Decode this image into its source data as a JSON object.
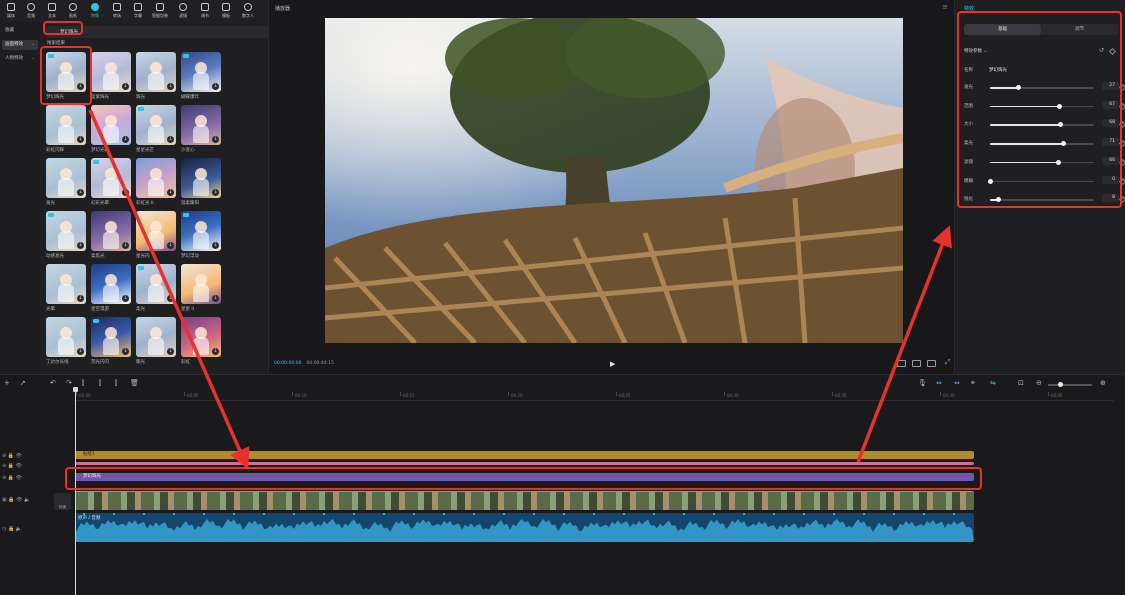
{
  "toolbar": {
    "items": [
      {
        "label": "媒体",
        "icon": "media-icon"
      },
      {
        "label": "音频",
        "icon": "audio-icon"
      },
      {
        "label": "文本",
        "icon": "text-icon"
      },
      {
        "label": "贴纸",
        "icon": "sticker-icon"
      },
      {
        "label": "特效",
        "icon": "effects-icon",
        "active": true
      },
      {
        "label": "转场",
        "icon": "transition-icon"
      },
      {
        "label": "字幕",
        "icon": "subtitle-icon"
      },
      {
        "label": "智能包装",
        "icon": "smart-pack-icon"
      },
      {
        "label": "滤镜",
        "icon": "filter-icon"
      },
      {
        "label": "调节",
        "icon": "adjust-icon"
      },
      {
        "label": "模板",
        "icon": "template-icon"
      },
      {
        "label": "数字人",
        "icon": "avatar-icon"
      }
    ]
  },
  "left_categories": [
    {
      "label": "收藏"
    },
    {
      "label": "画面特效",
      "selected": true
    },
    {
      "label": "人物特效"
    }
  ],
  "search": {
    "query": "梦幻辉光"
  },
  "grid_title": "搜索结果",
  "effects": [
    {
      "label": "梦幻辉光"
    },
    {
      "label": "蓝紫辉光"
    },
    {
      "label": "辉光"
    },
    {
      "label": "蝴蝶爆炸"
    },
    {
      "label": "彩虹闪辉"
    },
    {
      "label": "梦幻光斑"
    },
    {
      "label": "星星光芒"
    },
    {
      "label": "沙变心"
    },
    {
      "label": "发光"
    },
    {
      "label": "幻彩光晕"
    },
    {
      "label": "彩虹光 II"
    },
    {
      "label": "温柔暖阳"
    },
    {
      "label": "动感发光"
    },
    {
      "label": "柔焦光"
    },
    {
      "label": "星光闪"
    },
    {
      "label": "梦幻浮动"
    },
    {
      "label": "光晕"
    },
    {
      "label": "星空漫游"
    },
    {
      "label": "柔光"
    },
    {
      "label": "星星 II"
    },
    {
      "label": "丁达尔光线"
    },
    {
      "label": "荧光闪闪"
    },
    {
      "label": "暖光"
    },
    {
      "label": "彩虹"
    }
  ],
  "player": {
    "title": "播放器",
    "time_current": "00:00:00:00",
    "time_total": "00:00:44:15"
  },
  "right_panel": {
    "title": "特效",
    "tabs": [
      "基础",
      "调节"
    ],
    "section": "特效参数",
    "name_label": "名称",
    "name_value": "梦幻辉光",
    "params": [
      {
        "label": "发光",
        "value": 27
      },
      {
        "label": "范围",
        "value": 67
      },
      {
        "label": "大小",
        "value": 68
      },
      {
        "label": "柔光",
        "value": 71
      },
      {
        "label": "滤镜",
        "value": 66
      },
      {
        "label": "模糊",
        "value": 0
      },
      {
        "label": "锐化",
        "value": 8
      }
    ]
  },
  "timeline": {
    "ruler": [
      "00:00",
      "00:05",
      "00:10",
      "00:15",
      "00:20",
      "00:25",
      "00:30",
      "00:35",
      "00:40",
      "00:45"
    ],
    "clips": {
      "sticker": "贴纸1",
      "pink": "",
      "effect": "梦幻辉光",
      "cover": "封面",
      "audio": "原声 / 音频"
    }
  },
  "colors": {
    "accent": "#2ec6e0",
    "annotation": "#e5322d",
    "effect_clip": "#7355a8",
    "sticker_clip": "#b28c2b",
    "audio_clip": "#12466e"
  }
}
